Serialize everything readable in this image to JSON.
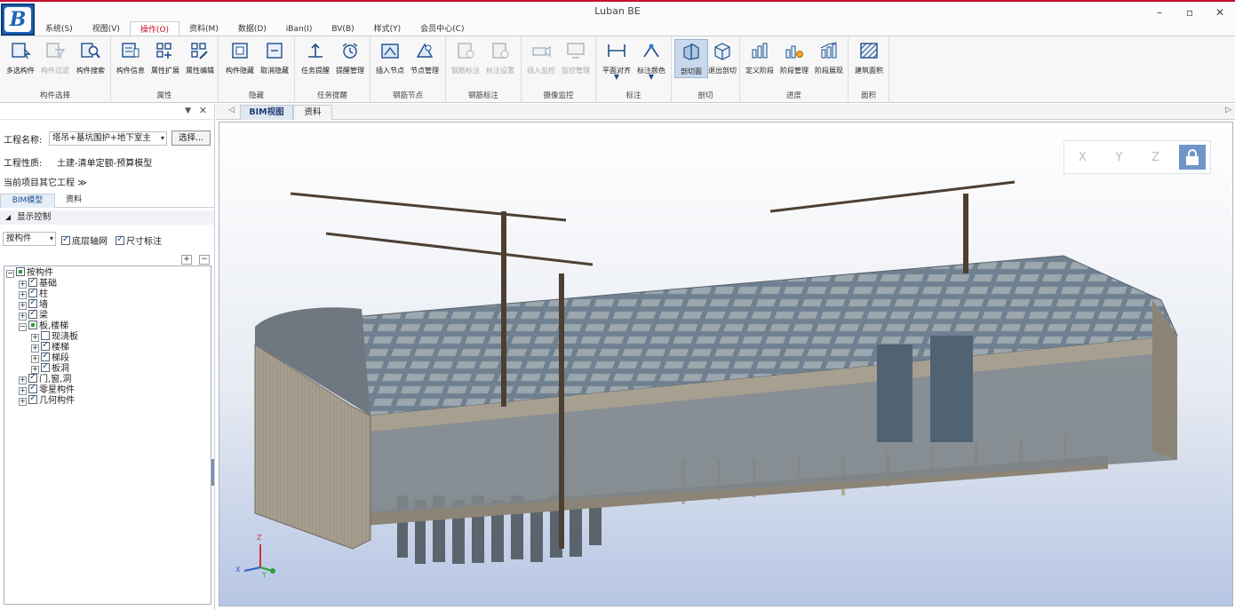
{
  "app": {
    "title": "Luban BE",
    "logo_letter": "B"
  },
  "window_controls": {
    "minimize": "–",
    "restore": "▫",
    "close": "✕"
  },
  "menu_tabs": [
    "系统(S)",
    "视图(V)",
    "操作(O)",
    "资料(M)",
    "数据(D)",
    "iBan(I)",
    "BV(B)",
    "样式(Y)",
    "会员中心(C)"
  ],
  "ribbon": {
    "groups": [
      {
        "label": "构件选择",
        "buttons": [
          "多选构件",
          "构件过滤",
          "构件搜索"
        ]
      },
      {
        "label": "属性",
        "buttons": [
          "构件信息",
          "属性扩展",
          "属性编辑"
        ]
      },
      {
        "label": "隐藏",
        "buttons": [
          "构件隐藏",
          "取消隐藏"
        ]
      },
      {
        "label": "任务提醒",
        "buttons": [
          "任务提醒",
          "提醒管理"
        ]
      },
      {
        "label": "钢筋节点",
        "buttons": [
          "插入节点",
          "节点管理"
        ]
      },
      {
        "label": "钢筋标注",
        "buttons": [
          "钢筋标注",
          "标注设置"
        ]
      },
      {
        "label": "摄像监控",
        "buttons": [
          "插入监控",
          "监控管理"
        ]
      },
      {
        "label": "标注",
        "buttons": [
          "平面对齐",
          "标注颜色"
        ]
      },
      {
        "label": "剖切",
        "buttons": [
          "剖切面",
          "退出剖切"
        ]
      },
      {
        "label": "进度",
        "buttons": [
          "定义阶段",
          "阶段管理",
          "阶段展现"
        ]
      },
      {
        "label": "面积",
        "buttons": [
          "建筑面积"
        ]
      }
    ]
  },
  "left_panel": {
    "project_name_label": "工程名称:",
    "project_name_value": "塔吊+基坑围护+地下室主",
    "choose_button": "选择...",
    "project_type_label": "工程性质:",
    "project_type_value": "土建-清单定额-预算模型",
    "other_projects": "当前项目其它工程",
    "other_projects_icon": "≫",
    "subtabs": [
      "BIM模型",
      "资料"
    ],
    "section": "显示控制",
    "filter_value": "按构件",
    "check_axis": "底层轴网",
    "check_dimension": "尺寸标注",
    "tree_add": "+",
    "tree_remove": "−",
    "tree": [
      "按构件",
      "基础",
      "柱",
      "墙",
      "梁",
      "板,楼梯",
      "现浇板",
      "楼梯",
      "梯段",
      "板洞",
      "门,窗,洞",
      "零星构件",
      "几何构件"
    ]
  },
  "doc_tabs": [
    "BIM视图",
    "资料"
  ],
  "viewcube": [
    "X",
    "Y",
    "Z"
  ],
  "axes": {
    "x": "X",
    "y": "Y",
    "z": "Z"
  }
}
